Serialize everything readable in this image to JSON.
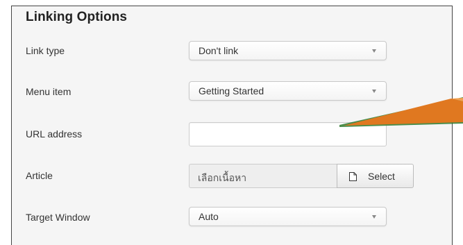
{
  "section": {
    "title": "Linking Options"
  },
  "fields": {
    "link_type": {
      "label": "Link type",
      "value": "Don't link"
    },
    "menu_item": {
      "label": "Menu item",
      "value": "Getting Started"
    },
    "url_address": {
      "label": "URL address",
      "value": ""
    },
    "article": {
      "label": "Article",
      "value": "เลือกเนื้อหา",
      "button_label": "Select",
      "button_icon": "file-icon"
    },
    "target_window": {
      "label": "Target Window",
      "value": "Auto"
    }
  },
  "annotation": {
    "arrow_color": "#e07820",
    "arrow_highlight": "#2d7a2d"
  },
  "colors": {
    "panel_bg": "#f5f5f5",
    "border": "#444444",
    "readonly_bg": "#eeeeee"
  }
}
